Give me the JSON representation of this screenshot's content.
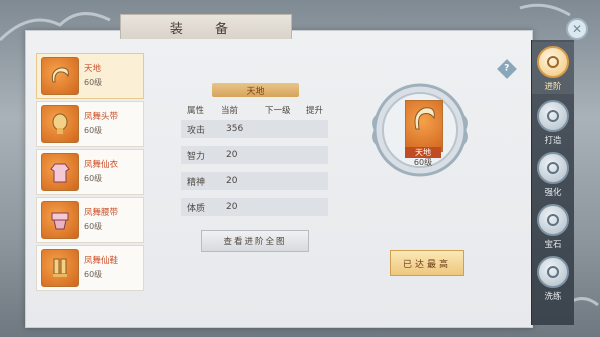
{
  "window": {
    "title": "装 备"
  },
  "items": [
    {
      "name": "天地",
      "level": "60级",
      "selected": true
    },
    {
      "name": "凤舞头带",
      "level": "60级",
      "selected": false
    },
    {
      "name": "凤舞仙衣",
      "level": "60级",
      "selected": false
    },
    {
      "name": "凤舞腰带",
      "level": "60级",
      "selected": false
    },
    {
      "name": "凤舞仙鞋",
      "level": "60级",
      "selected": false
    }
  ],
  "stats": {
    "title": "天地",
    "headers": {
      "attr": "属性",
      "current": "当前",
      "next": "下一级",
      "boost": "提升"
    },
    "rows": [
      {
        "name": "攻击",
        "value": "356"
      },
      {
        "name": "智力",
        "value": "20"
      },
      {
        "name": "精神",
        "value": "20"
      },
      {
        "name": "体质",
        "value": "20"
      }
    ]
  },
  "buttons": {
    "preview": "查看进阶全图",
    "max": "已达最高",
    "help": "?",
    "close": "✕"
  },
  "medallion": {
    "name": "天地",
    "level": "60级"
  },
  "nav": [
    {
      "label": "进阶",
      "active": true
    },
    {
      "label": "打造",
      "active": false
    },
    {
      "label": "强化",
      "active": false
    },
    {
      "label": "宝石",
      "active": false
    },
    {
      "label": "洗练",
      "active": false
    }
  ],
  "colors": {
    "accent": "#d6a45a",
    "item_name": "#c9502a",
    "panel": "#e7e9ec",
    "nav": "#434c55"
  }
}
